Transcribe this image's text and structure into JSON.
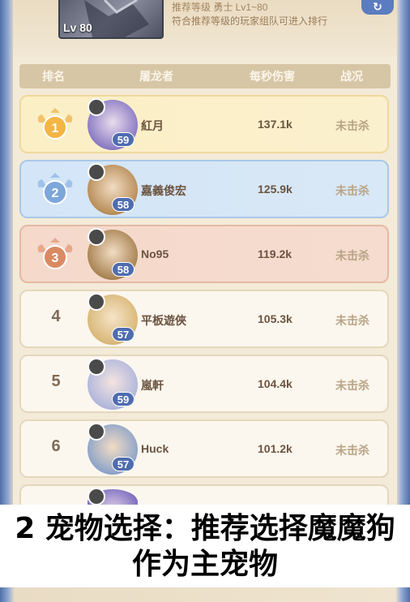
{
  "header": {
    "level_badge": "Lv 80",
    "recommend_line": "推荐等级 勇士 Lv1~80",
    "recommend_desc": "符合推荐等级的玩家组队可进入排行",
    "corner_icon": "refresh-icon"
  },
  "columns": {
    "rank": "排名",
    "player": "屠龙者",
    "dps": "每秒伤害",
    "status": "战况"
  },
  "rows": [
    {
      "rank": "1",
      "name": "紅月",
      "pet_level": "59",
      "dps": "137.1k",
      "status": "未击杀",
      "tier": "gold"
    },
    {
      "rank": "2",
      "name": "嘉義俊宏",
      "pet_level": "58",
      "dps": "125.9k",
      "status": "未击杀",
      "tier": "silver"
    },
    {
      "rank": "3",
      "name": "No95",
      "pet_level": "58",
      "dps": "119.2k",
      "status": "未击杀",
      "tier": "bronze"
    },
    {
      "rank": "4",
      "name": "平板遊俠",
      "pet_level": "57",
      "dps": "105.3k",
      "status": "未击杀",
      "tier": "normal"
    },
    {
      "rank": "5",
      "name": "嵐軒",
      "pet_level": "59",
      "dps": "104.4k",
      "status": "未击杀",
      "tier": "normal"
    },
    {
      "rank": "6",
      "name": "Huck",
      "pet_level": "57",
      "dps": "101.2k",
      "status": "未击杀",
      "tier": "normal"
    }
  ],
  "caption": {
    "line1": "2 宠物选择：推荐选择魔魔狗",
    "line2": "作为主宠物"
  },
  "colors": {
    "gold": "#fbefc6",
    "silver": "#d3e5f7",
    "bronze": "#f5d9cb",
    "frame_blue": "#4f6fa8"
  }
}
